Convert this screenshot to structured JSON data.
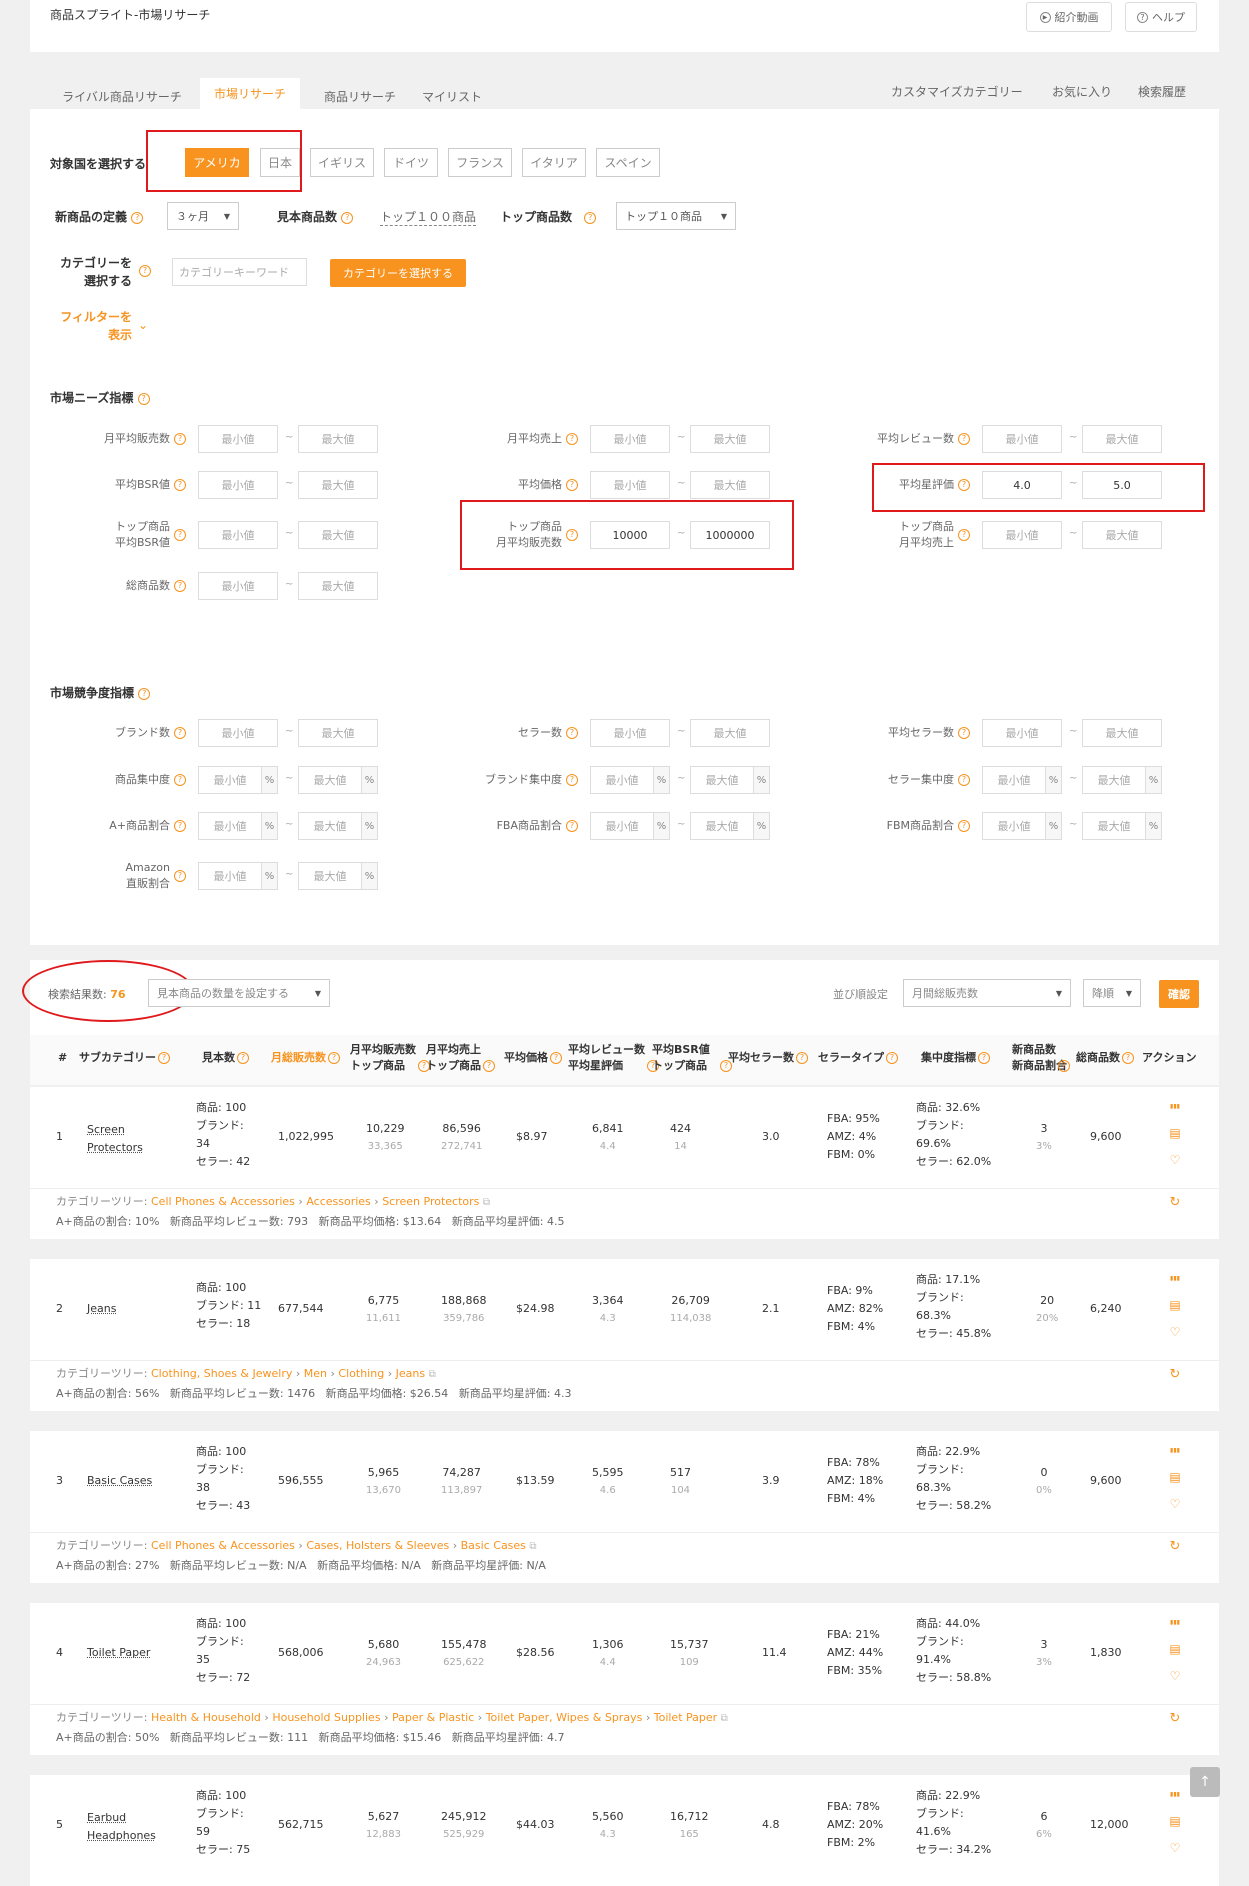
{
  "app": {
    "title": "商品スプライト-市場リサーチ",
    "intro_btn": "紹介動画",
    "help_btn": "ヘルプ"
  },
  "tabs": [
    {
      "label": "ライバル商品リサーチ",
      "active": false
    },
    {
      "label": "市場リサーチ",
      "active": true
    },
    {
      "label": "商品リサーチ",
      "active": false
    },
    {
      "label": "マイリスト",
      "active": false
    }
  ],
  "right_tabs": [
    "カスタマイズカテゴリー",
    "お気に入り",
    "検索履歴"
  ],
  "country": {
    "label": "対象国を選択する",
    "options": [
      "アメリカ",
      "日本",
      "イギリス",
      "ドイツ",
      "フランス",
      "イタリア",
      "スペイン"
    ],
    "selected": "アメリカ"
  },
  "settings": {
    "new_label": "新商品の定義",
    "new_value": "３ヶ月",
    "sample_label": "見本商品数",
    "sample_value": "トップ１００商品",
    "top_label": "トップ商品数",
    "top_value": "トップ１０商品"
  },
  "category": {
    "label_1": "カテゴリーを",
    "label_2": "選択する",
    "placeholder": "カテゴリーキーワード",
    "button": "カテゴリーを選択する"
  },
  "filter": {
    "label_1": "フィルターを",
    "label_2": "表示"
  },
  "ph": {
    "min": "最小値",
    "max": "最大値"
  },
  "needs": {
    "title": "市場ニーズ指標",
    "fields": [
      {
        "l1": "月平均販売数",
        "l2": "",
        "min": "",
        "max": ""
      },
      {
        "l1": "月平均売上",
        "l2": "",
        "min": "",
        "max": ""
      },
      {
        "l1": "平均レビュー数",
        "l2": "",
        "min": "",
        "max": ""
      },
      {
        "l1": "平均BSR値",
        "l2": "",
        "min": "",
        "max": ""
      },
      {
        "l1": "平均価格",
        "l2": "",
        "min": "",
        "max": ""
      },
      {
        "l1": "平均星評価",
        "l2": "",
        "min": "4.0",
        "max": "5.0"
      },
      {
        "l1": "トップ商品",
        "l2": "平均BSR値",
        "min": "",
        "max": ""
      },
      {
        "l1": "トップ商品",
        "l2": "月平均販売数",
        "min": "10000",
        "max": "1000000"
      },
      {
        "l1": "トップ商品",
        "l2": "月平均売上",
        "min": "",
        "max": ""
      },
      {
        "l1": "総商品数",
        "l2": "",
        "min": "",
        "max": ""
      }
    ]
  },
  "comp": {
    "title": "市場競争度指標",
    "fields": [
      {
        "l1": "ブランド数",
        "l2": ""
      },
      {
        "l1": "セラー数",
        "l2": ""
      },
      {
        "l1": "平均セラー数",
        "l2": ""
      },
      {
        "l1": "商品集中度",
        "l2": ""
      },
      {
        "l1": "ブランド集中度",
        "l2": ""
      },
      {
        "l1": "セラー集中度",
        "l2": ""
      },
      {
        "l1": "A+商品割合",
        "l2": ""
      },
      {
        "l1": "FBA商品割合",
        "l2": ""
      },
      {
        "l1": "FBM商品割合",
        "l2": ""
      },
      {
        "l1": "Amazon",
        "l2": "直販割合"
      }
    ]
  },
  "results": {
    "count_label": "検索結果数:",
    "count": "76",
    "sample_select": "見本商品の数量を設定する",
    "sort_label": "並び順設定",
    "sort_value": "月間総販売数",
    "order_value": "降順",
    "confirm": "確認"
  },
  "columns": [
    {
      "l1": "#",
      "l2": ""
    },
    {
      "l1": "サブカテゴリー",
      "l2": ""
    },
    {
      "l1": "見本数",
      "l2": ""
    },
    {
      "l1": "月総販売数",
      "l2": ""
    },
    {
      "l1": "月平均販売数",
      "l2": "トップ商品"
    },
    {
      "l1": "月平均売上",
      "l2": "トップ商品"
    },
    {
      "l1": "平均価格",
      "l2": ""
    },
    {
      "l1": "平均レビュー数",
      "l2": "平均星評価"
    },
    {
      "l1": "平均BSR値",
      "l2": "トップ商品"
    },
    {
      "l1": "平均セラー数",
      "l2": ""
    },
    {
      "l1": "セラータイプ",
      "l2": ""
    },
    {
      "l1": "集中度指標",
      "l2": ""
    },
    {
      "l1": "新商品数",
      "l2": "新商品割合"
    },
    {
      "l1": "総商品数",
      "l2": ""
    },
    {
      "l1": "アクション",
      "l2": ""
    }
  ],
  "rows": [
    {
      "no": "1",
      "name_1": "Screen",
      "name_2": "Protectors",
      "s1": "商品: 100",
      "s2": "ブランド:",
      "s3": "34",
      "s4": "セラー: 42",
      "total": "1,022,995",
      "avg": "10,229",
      "avg_top": "33,365",
      "rev": "86,596",
      "rev_top": "272,741",
      "price": "$8.97",
      "reviews": "6,841",
      "stars": "4.4",
      "bsr": "424",
      "bsr_top": "14",
      "sellers": "3.0",
      "fba": "FBA: 95%",
      "amz": "AMZ: 4%",
      "fbm": "FBM: 0%",
      "c1": "商品: 32.6%",
      "c2": "ブランド:",
      "c3": "69.6%",
      "c4": "セラー: 62.0%",
      "new": "3",
      "new_pct": "3%",
      "count": "9,600",
      "tree_label": "カテゴリーツリー:",
      "tree": [
        "Cell Phones & Accessories",
        "Accessories",
        "Screen Protectors"
      ],
      "aplus": "A+商品の割合: 10%",
      "new_reviews": "新商品平均レビュー数: 793",
      "new_price": "新商品平均価格: $13.64",
      "new_stars": "新商品平均星評価: 4.5"
    },
    {
      "no": "2",
      "name_1": "Jeans",
      "name_2": "",
      "s1": "商品: 100",
      "s2": "ブランド: 11",
      "s3": "",
      "s4": "セラー: 18",
      "total": "677,544",
      "avg": "6,775",
      "avg_top": "11,611",
      "rev": "188,868",
      "rev_top": "359,786",
      "price": "$24.98",
      "reviews": "3,364",
      "stars": "4.3",
      "bsr": "26,709",
      "bsr_top": "114,038",
      "sellers": "2.1",
      "fba": "FBA: 9%",
      "amz": "AMZ: 82%",
      "fbm": "FBM: 4%",
      "c1": "商品: 17.1%",
      "c2": "ブランド:",
      "c3": "68.3%",
      "c4": "セラー: 45.8%",
      "new": "20",
      "new_pct": "20%",
      "count": "6,240",
      "tree_label": "カテゴリーツリー:",
      "tree": [
        "Clothing, Shoes & Jewelry",
        "Men",
        "Clothing",
        "Jeans"
      ],
      "aplus": "A+商品の割合: 56%",
      "new_reviews": "新商品平均レビュー数: 1476",
      "new_price": "新商品平均価格: $26.54",
      "new_stars": "新商品平均星評価: 4.3"
    },
    {
      "no": "3",
      "name_1": "Basic Cases",
      "name_2": "",
      "s1": "商品: 100",
      "s2": "ブランド:",
      "s3": "38",
      "s4": "セラー: 43",
      "total": "596,555",
      "avg": "5,965",
      "avg_top": "13,670",
      "rev": "74,287",
      "rev_top": "113,897",
      "price": "$13.59",
      "reviews": "5,595",
      "stars": "4.6",
      "bsr": "517",
      "bsr_top": "104",
      "sellers": "3.9",
      "fba": "FBA: 78%",
      "amz": "AMZ: 18%",
      "fbm": "FBM: 4%",
      "c1": "商品: 22.9%",
      "c2": "ブランド:",
      "c3": "68.3%",
      "c4": "セラー: 58.2%",
      "new": "0",
      "new_pct": "0%",
      "count": "9,600",
      "tree_label": "カテゴリーツリー:",
      "tree": [
        "Cell Phones & Accessories",
        "Cases, Holsters & Sleeves",
        "Basic Cases"
      ],
      "aplus": "A+商品の割合: 27%",
      "new_reviews": "新商品平均レビュー数: N/A",
      "new_price": "新商品平均価格: N/A",
      "new_stars": "新商品平均星評価: N/A"
    },
    {
      "no": "4",
      "name_1": "Toilet Paper",
      "name_2": "",
      "s1": "商品: 100",
      "s2": "ブランド:",
      "s3": "35",
      "s4": "セラー: 72",
      "total": "568,006",
      "avg": "5,680",
      "avg_top": "24,963",
      "rev": "155,478",
      "rev_top": "625,622",
      "price": "$28.56",
      "reviews": "1,306",
      "stars": "4.4",
      "bsr": "15,737",
      "bsr_top": "109",
      "sellers": "11.4",
      "fba": "FBA: 21%",
      "amz": "AMZ: 44%",
      "fbm": "FBM: 35%",
      "c1": "商品: 44.0%",
      "c2": "ブランド:",
      "c3": "91.4%",
      "c4": "セラー: 58.8%",
      "new": "3",
      "new_pct": "3%",
      "count": "1,830",
      "tree_label": "カテゴリーツリー:",
      "tree": [
        "Health & Household",
        "Household Supplies",
        "Paper & Plastic",
        "Toilet Paper, Wipes & Sprays",
        "Toilet Paper"
      ],
      "aplus": "A+商品の割合: 50%",
      "new_reviews": "新商品平均レビュー数: 111",
      "new_price": "新商品平均価格: $15.46",
      "new_stars": "新商品平均星評価: 4.7"
    },
    {
      "no": "5",
      "name_1": "Earbud",
      "name_2": "Headphones",
      "s1": "商品: 100",
      "s2": "ブランド:",
      "s3": "59",
      "s4": "セラー: 75",
      "total": "562,715",
      "avg": "5,627",
      "avg_top": "12,883",
      "rev": "245,912",
      "rev_top": "525,929",
      "price": "$44.03",
      "reviews": "5,560",
      "stars": "4.3",
      "bsr": "16,712",
      "bsr_top": "165",
      "sellers": "4.8",
      "fba": "FBA: 78%",
      "amz": "AMZ: 20%",
      "fbm": "FBM: 2%",
      "c1": "商品: 22.9%",
      "c2": "ブランド:",
      "c3": "41.6%",
      "c4": "セラー: 34.2%",
      "new": "6",
      "new_pct": "6%",
      "count": "12,000",
      "tree_label": "",
      "tree": [],
      "aplus": "",
      "new_reviews": "",
      "new_price": "",
      "new_stars": ""
    }
  ],
  "colors": {
    "accent": "#f7931e",
    "highlight": "#e0191c"
  }
}
